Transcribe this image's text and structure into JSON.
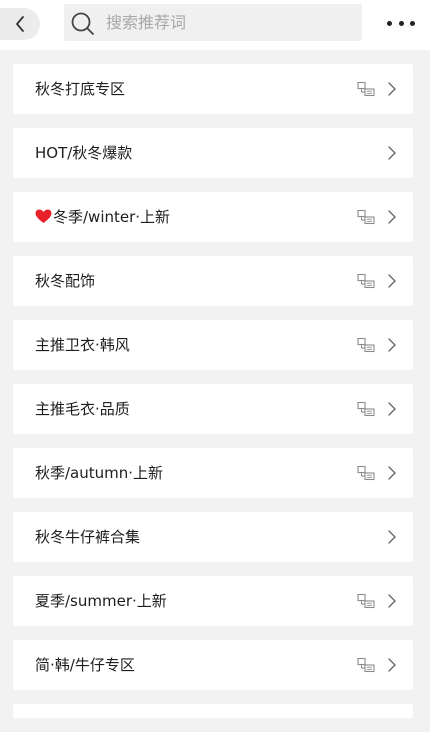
{
  "header": {
    "search_placeholder": "搜索推荐词"
  },
  "categories": [
    {
      "label": "秋冬打底专区",
      "has_mini_icon": true
    },
    {
      "label": "HOT/秋冬爆款",
      "has_mini_icon": false
    },
    {
      "label": "冬季/winter·上新",
      "has_mini_icon": true,
      "prefix_icon": "heart-icon"
    },
    {
      "label": "秋冬配饰",
      "has_mini_icon": true
    },
    {
      "label": "主推卫衣·韩风",
      "has_mini_icon": true
    },
    {
      "label": "主推毛衣·品质",
      "has_mini_icon": true
    },
    {
      "label": "秋季/autumn·上新",
      "has_mini_icon": true
    },
    {
      "label": "秋冬牛仔裤合集",
      "has_mini_icon": false
    },
    {
      "label": "夏季/summer·上新",
      "has_mini_icon": true
    },
    {
      "label": "简·韩/牛仔专区",
      "has_mini_icon": true
    }
  ],
  "colors": {
    "background": "#f2f2f2",
    "row_background": "#ffffff",
    "heart": "#e8202a",
    "icon_grey": "#8a8a8a"
  }
}
